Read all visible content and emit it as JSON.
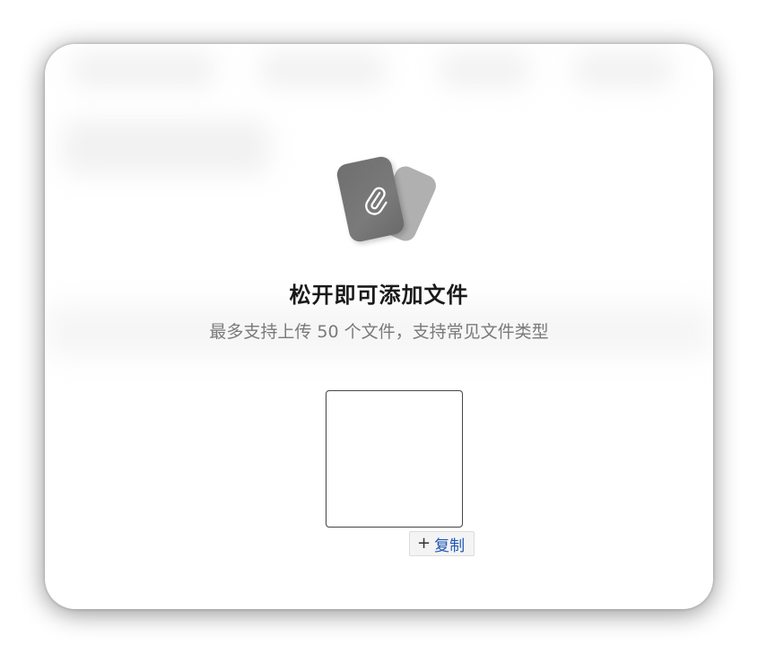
{
  "overlay": {
    "title": "松开即可添加文件",
    "subtitle": "最多支持上传 50 个文件，支持常见文件类型"
  },
  "drag_badge": {
    "plus_symbol": "+",
    "label": "复制"
  },
  "icons": {
    "upload": "paperclip-icon",
    "badge": "plus-icon"
  },
  "colors": {
    "card_front": "#737373",
    "card_back": "#b0b0b0",
    "badge_label": "#1f56b3",
    "title": "#1a1a1a",
    "subtitle": "#7a7a7a"
  }
}
